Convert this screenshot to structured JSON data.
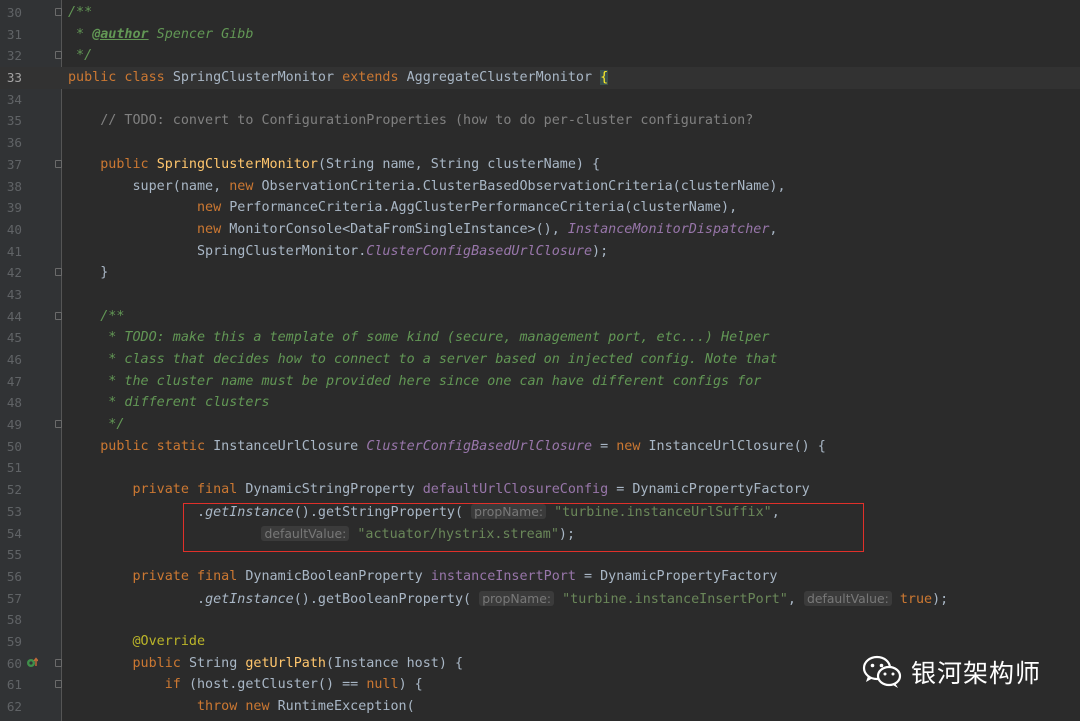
{
  "editor": {
    "gutter": {
      "line_numbers": [
        "30",
        "31",
        "32",
        "33",
        "34",
        "35",
        "36",
        "37",
        "38",
        "39",
        "40",
        "41",
        "42",
        "43",
        "44",
        "45",
        "46",
        "47",
        "48",
        "49",
        "50",
        "51",
        "52",
        "53",
        "54",
        "55",
        "56",
        "57",
        "58",
        "59",
        "60",
        "61",
        "62"
      ],
      "current_line": "33"
    },
    "code": {
      "l30": "/**",
      "l31_a": " * ",
      "l31_tag": "@author",
      "l31_b": " Spencer Gibb",
      "l32": " */",
      "l33_kw1": "public class ",
      "l33_name": "SpringClusterMonitor ",
      "l33_kw2": "extends ",
      "l33_base": "AggregateClusterMonitor ",
      "l33_brace": "{",
      "l35": "    // TODO: convert to ConfigurationProperties (how to do per-cluster configuration?",
      "l37_kw": "    public ",
      "l37_fn": "SpringClusterMonitor",
      "l37_p1": "(String name, String clusterName) {",
      "l38_a": "        super(name, ",
      "l38_kw": "new ",
      "l38_b": "ObservationCriteria.ClusterBasedObservationCriteria(clusterName),",
      "l39_kw": "                new ",
      "l39_b": "PerformanceCriteria.AggClusterPerformanceCriteria(clusterName),",
      "l40_kw": "                new ",
      "l40_b": "MonitorConsole<DataFromSingleInstance>(), ",
      "l40_sf": "InstanceMonitorDispatcher",
      "l40_c": ",",
      "l41_a": "                SpringClusterMonitor.",
      "l41_sf": "ClusterConfigBasedUrlClosure",
      "l41_b": ");",
      "l42": "    }",
      "l44": "    /**",
      "l45": "     * TODO: make this a template of some kind (secure, management port, etc...) Helper",
      "l46": "     * class that decides how to connect to a server based on injected config. Note that",
      "l47": "     * the cluster name must be provided here since one can have different configs for",
      "l48": "     * different clusters",
      "l49": "     */",
      "l50_kw": "    public static ",
      "l50_a": "InstanceUrlClosure ",
      "l50_sf": "ClusterConfigBasedUrlClosure",
      "l50_b": " = ",
      "l50_kw2": "new ",
      "l50_c": "InstanceUrlClosure() {",
      "l52_kw": "        private final ",
      "l52_a": "DynamicStringProperty ",
      "l52_fld": "defaultUrlClosureConfig",
      "l52_b": " = DynamicPropertyFactory",
      "l53_a": "                .",
      "l53_stm": "getInstance",
      "l53_b": "().getStringProperty(",
      "l53_hint": "propName:",
      "l53_str": "\"turbine.instanceUrlSuffix\"",
      "l53_c": ",",
      "l54_pad": "                        ",
      "l54_hint": "defaultValue:",
      "l54_str": "\"actuator/hystrix.stream\"",
      "l54_b": ");",
      "l56_kw": "        private final ",
      "l56_a": "DynamicBooleanProperty ",
      "l56_fld": "instanceInsertPort",
      "l56_b": " = DynamicPropertyFactory",
      "l57_a": "                .",
      "l57_stm": "getInstance",
      "l57_b": "().getBooleanProperty(",
      "l57_hint1": "propName:",
      "l57_str": "\"turbine.instanceInsertPort\"",
      "l57_c": ", ",
      "l57_hint2": "defaultValue:",
      "l57_kw": "true",
      "l57_d": ");",
      "l59": "        @Override",
      "l60_kw": "        public ",
      "l60_a": "String ",
      "l60_fn": "getUrlPath",
      "l60_b": "(Instance host) {",
      "l61_kw": "            if ",
      "l61_a": "(host.getCluster() == ",
      "l61_kw2": "null",
      "l61_b": ") {",
      "l62_kw": "                throw new ",
      "l62_a": "RuntimeException("
    }
  },
  "colors": {
    "background": "#2b2b2b",
    "gutter": "#313335",
    "keyword": "#cc7832",
    "string": "#6a8759",
    "doc_comment": "#629755",
    "method": "#ffc66d",
    "field": "#9876aa",
    "highlight_box": "#e0302a"
  },
  "watermark": {
    "icon": "wechat-icon",
    "text": "银河架构师"
  }
}
